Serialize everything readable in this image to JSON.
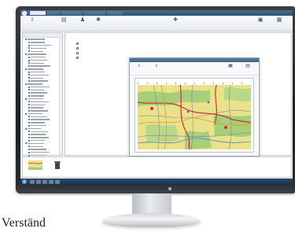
{
  "caption": "Verständ",
  "tabs": [
    "",
    "",
    "",
    "",
    ""
  ],
  "toolbar": {
    "items": [
      "",
      "",
      "",
      "",
      "",
      "",
      ""
    ]
  },
  "tree": {
    "header": ""
  },
  "content": {
    "breadcrumb": "",
    "subhead": "",
    "list": [
      "",
      "",
      "",
      ""
    ]
  },
  "viewer": {
    "title": "",
    "tools": [
      "",
      "",
      "",
      ""
    ],
    "map_caption": ""
  },
  "thumbnails": [
    "",
    ""
  ],
  "taskbar": {
    "clock": ""
  },
  "colors": {
    "titlebar": "#2e5275",
    "map_land": "#e9e28a",
    "map_forest": "#a7cf7a",
    "map_road": "#c0392b",
    "taskbar": "#18324f"
  }
}
